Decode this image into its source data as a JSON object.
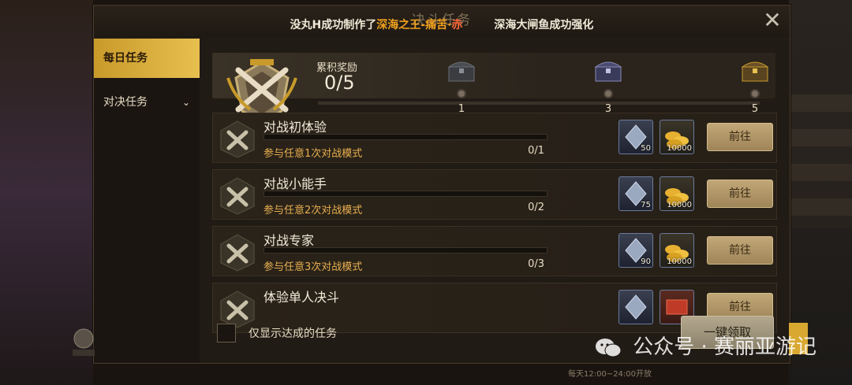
{
  "modal": {
    "title": "决斗任务",
    "notice": {
      "prefix": "没丸H成功制作了",
      "item": "深海之王-痛苦·",
      "suffix": "赤",
      "second": "深海大闸鱼成功强化"
    },
    "close_label": "✕"
  },
  "sidebar": {
    "items": [
      {
        "label": "每日任务",
        "active": true
      },
      {
        "label": "对决任务",
        "active": false,
        "chevron": "⌄"
      }
    ]
  },
  "rewards": {
    "label": "累积奖励",
    "count": "0/5",
    "milestones": [
      {
        "value": "1",
        "icon": "chest-dark-icon"
      },
      {
        "value": "3",
        "icon": "chest-purple-icon"
      },
      {
        "value": "5",
        "icon": "chest-gold-icon"
      }
    ]
  },
  "tasks": [
    {
      "name": "对战初体验",
      "desc": "参与任意1次对战模式",
      "progress": "0/1",
      "progress_fraction": 0,
      "reward1": {
        "icon": "crystal-icon",
        "qty": "50"
      },
      "reward2": {
        "icon": "gold-coins-icon",
        "qty": "10000"
      },
      "button": "前往"
    },
    {
      "name": "对战小能手",
      "desc": "参与任意2次对战模式",
      "progress": "0/2",
      "progress_fraction": 0,
      "reward1": {
        "icon": "crystal-icon",
        "qty": "75"
      },
      "reward2": {
        "icon": "gold-coins-icon",
        "qty": "10000"
      },
      "button": "前往"
    },
    {
      "name": "对战专家",
      "desc": "参与任意3次对战模式",
      "progress": "0/3",
      "progress_fraction": 0,
      "reward1": {
        "icon": "crystal-icon",
        "qty": "90"
      },
      "reward2": {
        "icon": "gold-coins-icon",
        "qty": "10000"
      },
      "button": "前往"
    },
    {
      "name": "体验单人决斗",
      "desc": "",
      "progress": "",
      "reward1": {
        "icon": "crystal-icon",
        "qty": ""
      },
      "reward2": {
        "icon": "red-ticket-icon",
        "qty": ""
      },
      "button": "前往"
    }
  ],
  "bottom": {
    "checkbox_label": "仅显示达成的任务",
    "claim_all": "一键领取"
  },
  "watermark": "公众号 · 赛丽亚游记",
  "footer_note": "每天12:00~24:00开放",
  "colors": {
    "accent_gold": "#e8c050",
    "highlight_orange": "#f0a020",
    "task_desc": "#e8b050"
  }
}
